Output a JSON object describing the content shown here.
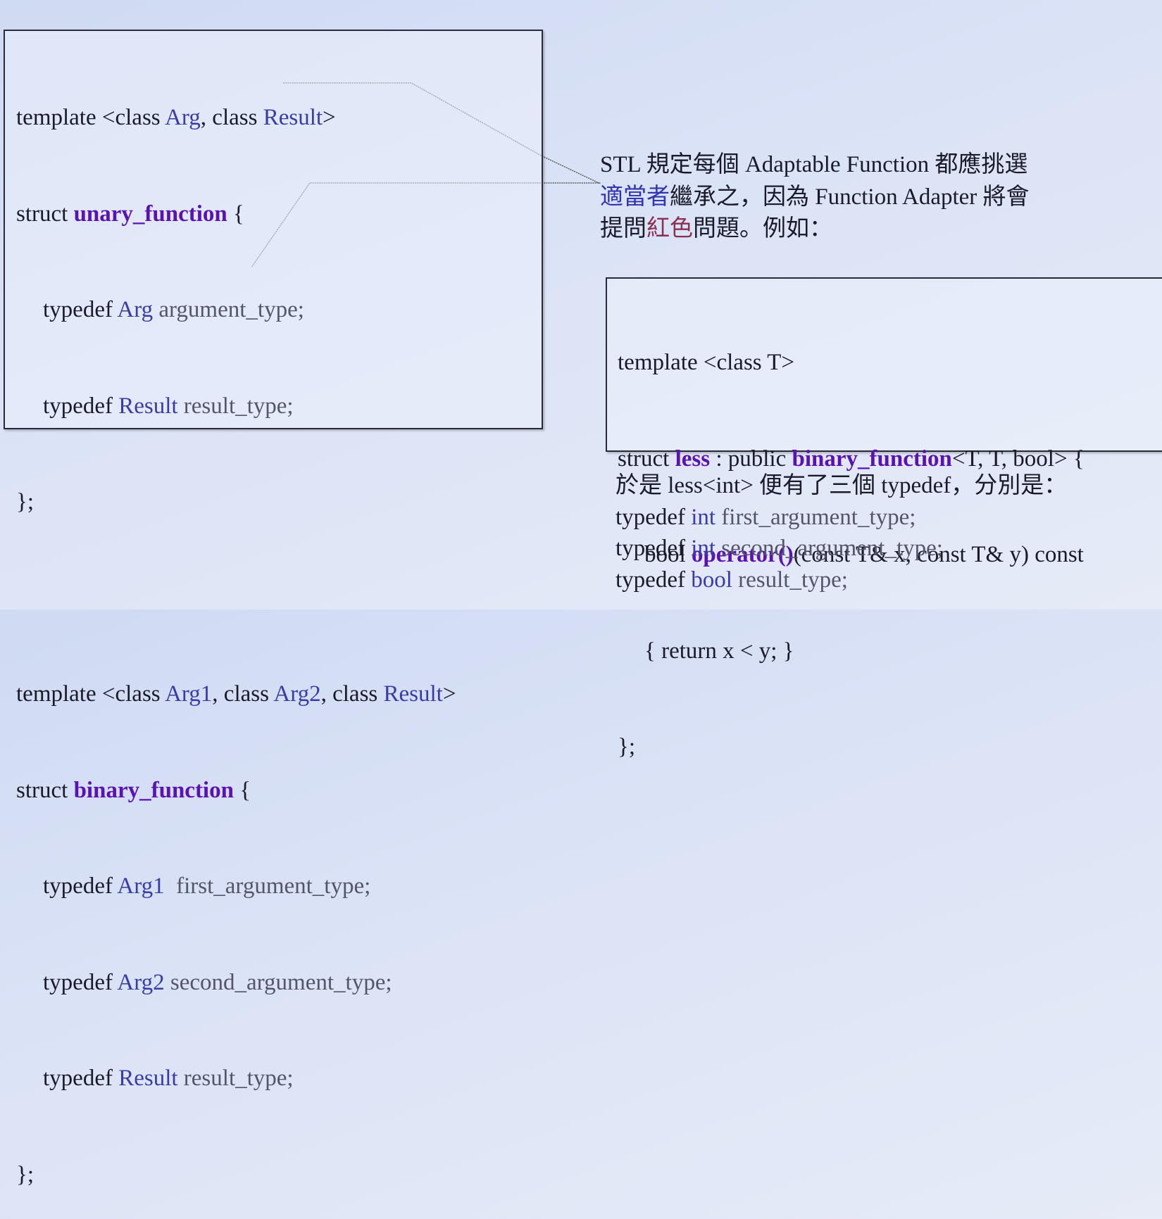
{
  "unary": {
    "l1": {
      "a": "template <class ",
      "b": "Arg",
      ",": ", class ",
      "c": "Result",
      ">": ">"
    },
    "l2": {
      "a": "struct ",
      "b": "unary_function",
      "c": " {"
    },
    "l3": {
      "a": "typedef ",
      "b": "Arg",
      "c": " argument_type;"
    },
    "l4": {
      "a": "typedef ",
      "b": "Result",
      "c": " result_type;"
    },
    "l5": "};"
  },
  "binary": {
    "l1": {
      "a": "template <class ",
      "b": "Arg1",
      "c": ", class ",
      "d": "Arg2",
      "e": ", class ",
      "f": "Result",
      "g": ">"
    },
    "l2": {
      "a": "struct ",
      "b": "binary_function",
      "c": " {"
    },
    "l3": {
      "a": "typedef ",
      "b": "Arg1",
      "c": "  first_argument_type;"
    },
    "l4": {
      "a": "typedef ",
      "b": "Arg2",
      "c": " second_argument_type;"
    },
    "l5": {
      "a": "typedef ",
      "b": "Result",
      "c": " result_type;"
    },
    "l6": "};"
  },
  "note": {
    "l1": "STL 規定每個 Adaptable Function 都應挑選",
    "l2a": "適當者",
    "l2b": "繼承之，因為 Function Adapter 將會",
    "l3a": "提問",
    "l3b": "紅色",
    "l3c": "問題。例如："
  },
  "less": {
    "l1": "template <class T>",
    "l2": {
      "a": "struct ",
      "b": "less",
      "c": " : public ",
      "d": "binary_function",
      "e": "<T, T, bool> {"
    },
    "l3": {
      "a": "bool ",
      "b": "operator()",
      "c": "(const T& x, const T& y) const"
    },
    "l4": "{ return x < y; }",
    "l5": "};"
  },
  "result": {
    "intro": "於是 less<int> 便有了三個 typedef，分別是：",
    "r1": {
      "a": "typedef ",
      "b": "int",
      "c": " first_argument_type;"
    },
    "r2": {
      "a": "typedef ",
      "b": "int",
      "c": " second_argument_type;"
    },
    "r3": {
      "a": "typedef ",
      "b": "bool",
      "c": " result_type;"
    }
  }
}
